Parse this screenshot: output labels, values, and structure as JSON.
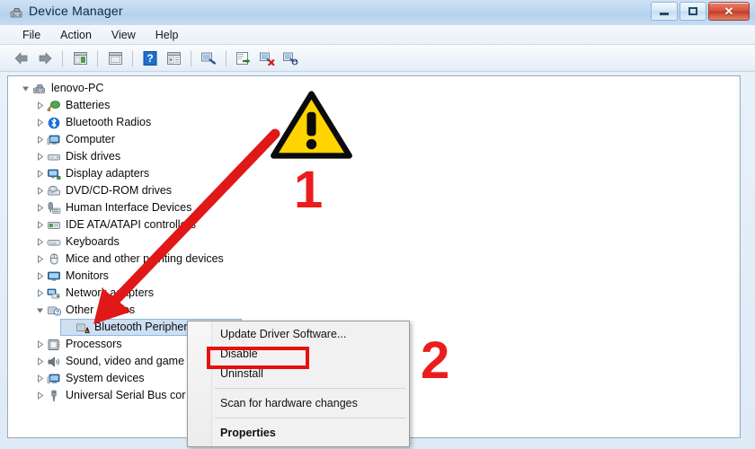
{
  "window": {
    "title": "Device Manager",
    "icon": "device-manager-icon",
    "watermark": "",
    "buttons": {
      "minimize": "Minimize",
      "maximize": "Maximize",
      "close": "Close"
    }
  },
  "menubar": {
    "items": [
      {
        "label": "File"
      },
      {
        "label": "Action"
      },
      {
        "label": "View"
      },
      {
        "label": "Help"
      }
    ]
  },
  "toolbar": {
    "items": [
      {
        "name": "back-icon",
        "tooltip": "Back"
      },
      {
        "name": "forward-icon",
        "tooltip": "Forward"
      },
      {
        "name": "show-hide-console-tree-icon",
        "tooltip": "Show/Hide Console Tree"
      },
      {
        "name": "properties-icon",
        "tooltip": "Properties"
      },
      {
        "name": "help-icon",
        "tooltip": "Help"
      },
      {
        "name": "show-hide-action-pane-icon",
        "tooltip": "Show/Hide Action Pane"
      },
      {
        "name": "scan-hardware-changes-icon",
        "tooltip": "Scan for hardware changes"
      },
      {
        "name": "update-driver-icon",
        "tooltip": "Update Driver Software"
      },
      {
        "name": "disable-device-icon",
        "tooltip": "Disable"
      },
      {
        "name": "uninstall-device-icon",
        "tooltip": "Uninstall"
      }
    ]
  },
  "tree": {
    "root": {
      "label": "lenovo-PC",
      "icon": "computer-icon",
      "expanded": true
    },
    "items": [
      {
        "label": "Batteries",
        "icon": "battery-icon",
        "level": 1,
        "expanded": false
      },
      {
        "label": "Bluetooth Radios",
        "icon": "bluetooth-icon",
        "level": 1,
        "expanded": false
      },
      {
        "label": "Computer",
        "icon": "computer-icon",
        "level": 1,
        "expanded": false
      },
      {
        "label": "Disk drives",
        "icon": "disk-icon",
        "level": 1,
        "expanded": false
      },
      {
        "label": "Display adapters",
        "icon": "display-icon",
        "level": 1,
        "expanded": false
      },
      {
        "label": "DVD/CD-ROM drives",
        "icon": "dvd-icon",
        "level": 1,
        "expanded": false
      },
      {
        "label": "Human Interface Devices",
        "icon": "hid-icon",
        "level": 1,
        "expanded": false
      },
      {
        "label": "IDE ATA/ATAPI controllers",
        "icon": "ide-icon",
        "level": 1,
        "expanded": false
      },
      {
        "label": "Keyboards",
        "icon": "keyboard-icon",
        "level": 1,
        "expanded": false
      },
      {
        "label": "Mice and other pointing devices",
        "icon": "mouse-icon",
        "level": 1,
        "expanded": false
      },
      {
        "label": "Monitors",
        "icon": "monitor-icon",
        "level": 1,
        "expanded": false
      },
      {
        "label": "Network adapters",
        "icon": "network-icon",
        "level": 1,
        "expanded": false
      },
      {
        "label": "Other devices",
        "icon": "unknown-device-icon",
        "level": 1,
        "expanded": true
      },
      {
        "label": "Bluetooth Peripheral",
        "icon": "warning-device-icon",
        "level": 2,
        "selected": true
      },
      {
        "label": "Processors",
        "icon": "processor-icon",
        "level": 1,
        "expanded": false
      },
      {
        "label": "Sound, video and game",
        "icon": "sound-icon",
        "level": 1,
        "expanded": false
      },
      {
        "label": "System devices",
        "icon": "system-icon",
        "level": 1,
        "expanded": false
      },
      {
        "label": "Universal Serial Bus cor",
        "icon": "usb-icon",
        "level": 1,
        "expanded": false
      }
    ]
  },
  "context_menu": {
    "items": [
      {
        "label": "Update Driver Software...",
        "type": "item"
      },
      {
        "label": "Disable",
        "type": "item",
        "highlighted": true
      },
      {
        "label": "Uninstall",
        "type": "item"
      },
      {
        "label": "",
        "type": "separator"
      },
      {
        "label": "Scan for hardware changes",
        "type": "item"
      },
      {
        "label": "",
        "type": "separator"
      },
      {
        "label": "Properties",
        "type": "item",
        "bold": true
      }
    ]
  },
  "annotations": {
    "warning_icon": "warning-triangle-icon",
    "step_one": "1",
    "step_two": "2",
    "arrow": "red-arrow-pointing-to-other-devices"
  },
  "colors": {
    "annotation_red": "#ec1c1c",
    "highlight_red": "#e8100f",
    "warning_yellow": "#ffd200",
    "selection_blue": "#cddff2",
    "titlebar_blue": "#bcd7f0"
  }
}
